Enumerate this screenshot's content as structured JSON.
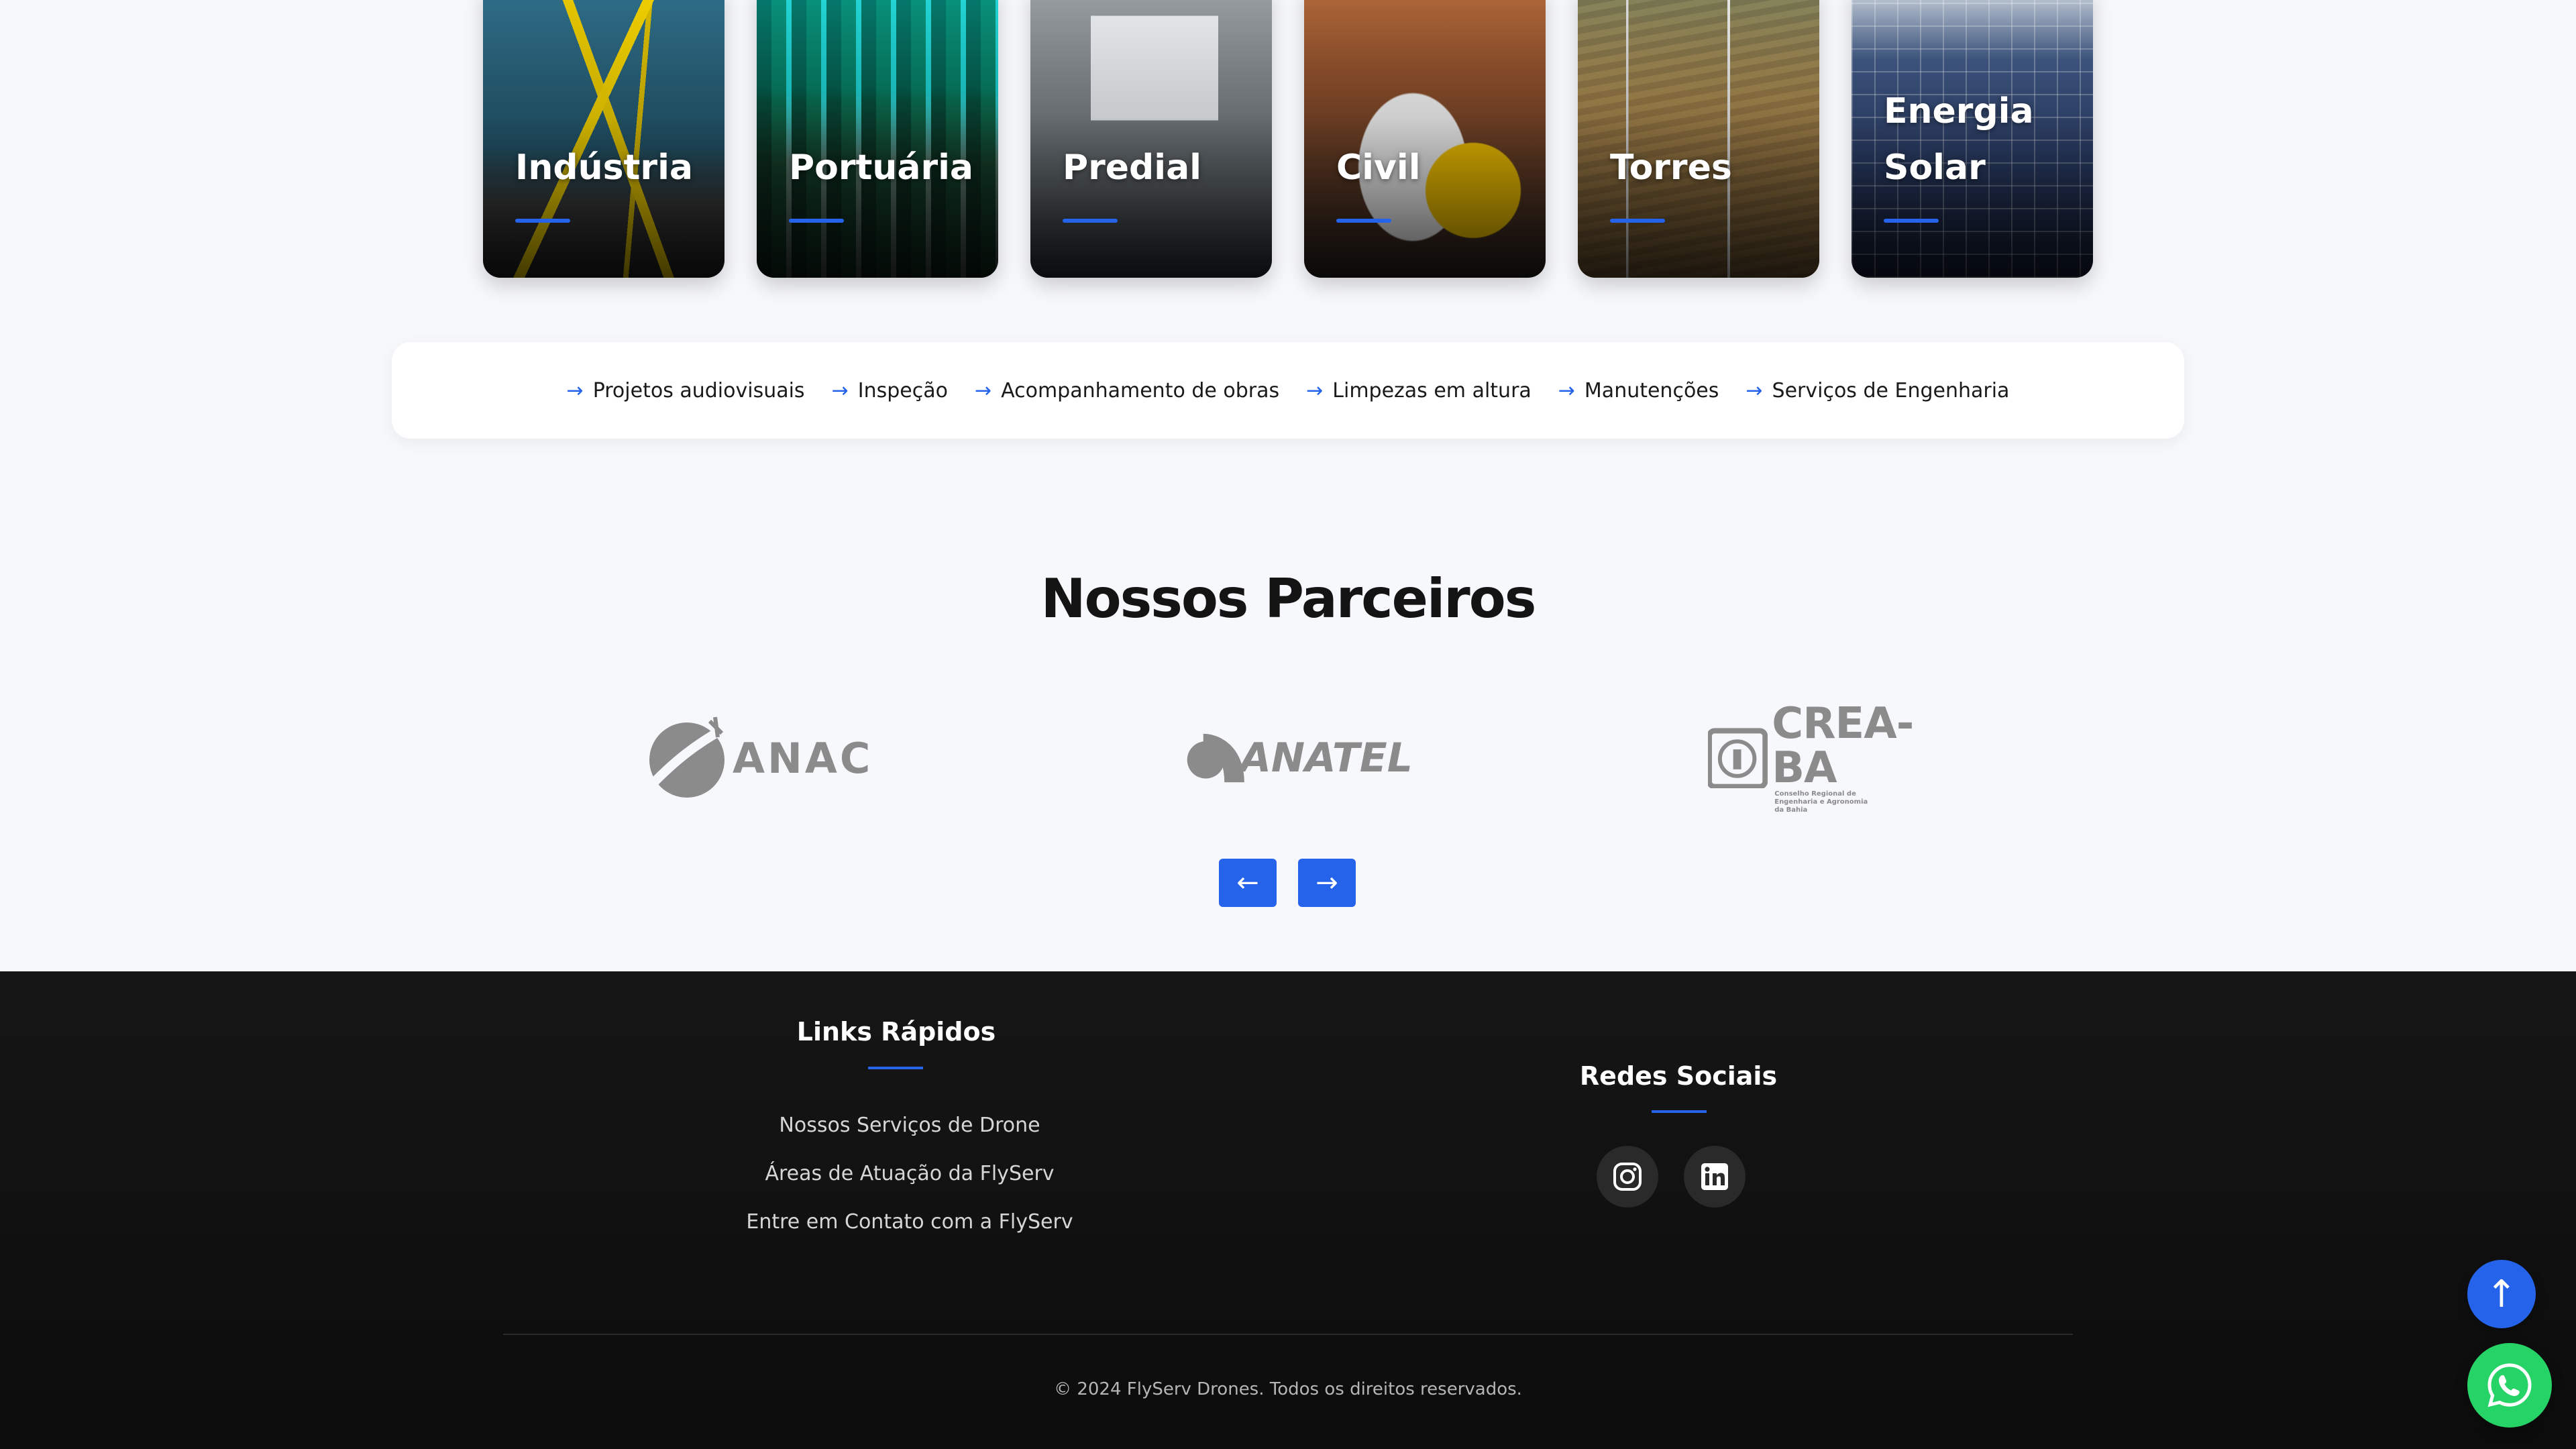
{
  "areas": {
    "cards": [
      {
        "title": "Indústria"
      },
      {
        "title": "Portuária"
      },
      {
        "title": "Predial"
      },
      {
        "title": "Civil"
      },
      {
        "title": "Torres"
      },
      {
        "title": "Energia Solar"
      }
    ]
  },
  "services": {
    "items": [
      {
        "label": "Projetos audiovisuais"
      },
      {
        "label": "Inspeção"
      },
      {
        "label": "Acompanhamento de obras"
      },
      {
        "label": "Limpezas em altura"
      },
      {
        "label": "Manutenções"
      },
      {
        "label": "Serviços de Engenharia"
      }
    ],
    "arrow_glyph": "→"
  },
  "partners": {
    "title": "Nossos Parceiros",
    "logos": [
      {
        "name": "ANAC"
      },
      {
        "name": "ANATEL"
      },
      {
        "name": "CREA-BA",
        "subtitle": "Conselho Regional de Engenharia e Agronomia da Bahia"
      }
    ],
    "prev_label": "←",
    "next_label": "→"
  },
  "footer": {
    "quick_links": {
      "title": "Links Rápidos",
      "items": [
        {
          "label": "Nossos Serviços de Drone"
        },
        {
          "label": "Áreas de Atuação da FlyServ"
        },
        {
          "label": "Entre em Contato com a FlyServ"
        }
      ]
    },
    "social": {
      "title": "Redes Sociais",
      "items": [
        {
          "icon": "instagram-icon"
        },
        {
          "icon": "linkedin-icon"
        }
      ]
    },
    "copyright": "© 2024 FlyServ Drones. Todos os direitos reservados."
  },
  "floating": {
    "scroll_top_label": "↑",
    "whatsapp_icon": "whatsapp-icon"
  },
  "colors": {
    "accent": "#2563eb",
    "whatsapp": "#25d366",
    "footer_bg": "#111111",
    "page_bg": "#f7f8fb"
  }
}
